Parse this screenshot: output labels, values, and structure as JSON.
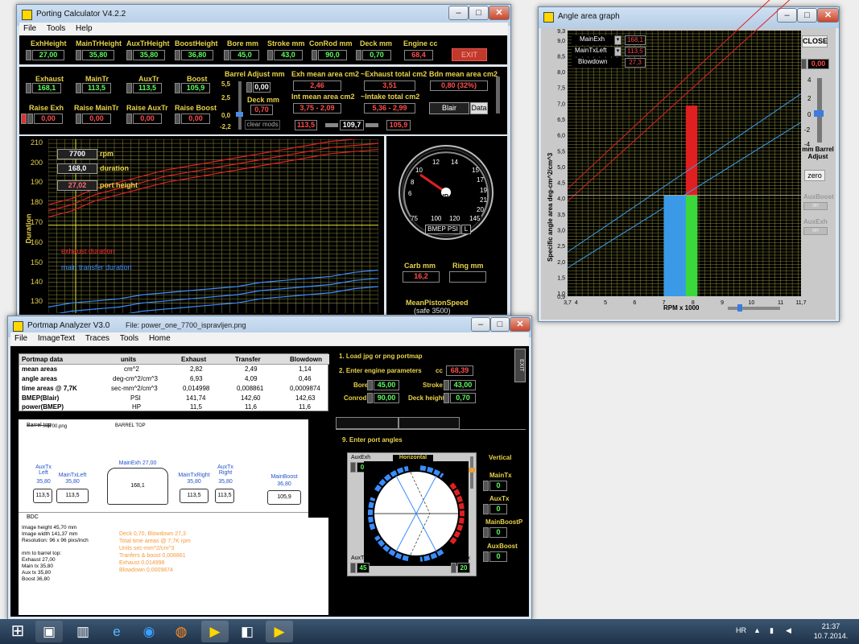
{
  "porting": {
    "title": "Porting Calculator V4.2.2",
    "menu": [
      "File",
      "Tools",
      "Help"
    ],
    "top_fields": [
      {
        "label": "ExhHeight",
        "value": "27,00"
      },
      {
        "label": "MainTrHeight",
        "value": "35,80"
      },
      {
        "label": "AuxTrHeight",
        "value": "35,80"
      },
      {
        "label": "BoostHeight",
        "value": "36,80"
      },
      {
        "label": "Bore mm",
        "value": "45,0"
      },
      {
        "label": "Stroke mm",
        "value": "43,0"
      },
      {
        "label": "ConRod mm",
        "value": "90,0"
      },
      {
        "label": "Deck mm",
        "value": "0,70"
      },
      {
        "label": "Engine cc",
        "value": "68,4"
      }
    ],
    "exit_label": "EXIT",
    "dur_fields": [
      {
        "label": "Exhaust",
        "value": "168,1"
      },
      {
        "label": "MainTr",
        "value": "113,5"
      },
      {
        "label": "AuxTr",
        "value": "113,5"
      },
      {
        "label": "Boost",
        "value": "105,9"
      }
    ],
    "raise_fields": [
      {
        "label": "Raise Exh",
        "value": "0,00"
      },
      {
        "label": "Raise MainTr",
        "value": "0,00"
      },
      {
        "label": "Raise AuxTr",
        "value": "0,00"
      },
      {
        "label": "Raise Boost",
        "value": "0,00"
      }
    ],
    "barrel_adjust_label": "Barrel Adjust mm",
    "barrel_adjust_value": "0,00",
    "barrel_scale": [
      "5,5",
      "2,5",
      "0,0",
      "-2,2"
    ],
    "deck_label": "Deck mm",
    "deck_value": "0,70",
    "clear_mods": "clear mods",
    "exh_mean_label": "Exh mean area cm2",
    "exh_mean_value": "2,46",
    "exh_total_label": "~Exhaust total cm2",
    "exh_total_value": "3,51",
    "bdn_label": "Bdn mean area cm2",
    "bdn_value": "0,80  (32%)",
    "int_mean_label": "Int mean area cm2",
    "int_mean_value": "3,75 - 2,09",
    "int_total_label": "~Intake total cm2",
    "int_total_value": "5,36 - 2,99",
    "blair_btn": "Blair",
    "data_btn": "Data",
    "val_a": "113,5",
    "val_b": "109,7",
    "val_c": "105,9",
    "rpm_value": "7700",
    "rpm_label": "rpm",
    "duration_value": "168,0",
    "duration_label": "duration",
    "port_height_value": "27,02",
    "port_height_label": "port height",
    "yaxis_label": "Duration",
    "y_ticks": [
      "210",
      "200",
      "190",
      "180",
      "170",
      "160",
      "150",
      "140",
      "130"
    ],
    "series_exhaust": "exhaust duration",
    "series_transfer": "main transfer duration",
    "gauge_ticks": [
      "10",
      "8",
      "6",
      "12",
      "14",
      "15",
      "17",
      "19",
      "21",
      "20",
      "75",
      "100",
      "120",
      "145"
    ],
    "gauge_unit": "HP",
    "gauge_mode": "BMEP PSI",
    "gauge_mode_sel": "L",
    "carb_label": "Carb mm",
    "carb_value": "16,2",
    "ring_label": "Ring mm",
    "piston_speed_label": "MeanPistonSpeed",
    "piston_speed_sub": "(safe 3500)"
  },
  "angle": {
    "title": "Angle area graph",
    "legend": [
      {
        "name": "MainExh",
        "value": "168,1"
      },
      {
        "name": "MainTxLeft",
        "value": "113,5"
      },
      {
        "name": "Blowdown",
        "value": "27,3"
      }
    ],
    "close_btn": "CLOSE",
    "adjust_value": "0,00",
    "adjust_ticks": [
      "4",
      "2",
      "0",
      "-2",
      "-4"
    ],
    "adjust_label": "mm Barrel Adjust",
    "zero_btn": "zero",
    "auxboost_label": "AuxBoost",
    "auxexh_label": "AuxExh",
    "on_label": "on",
    "ylabel": "Specific angle area  deg-cm^2/cm^3",
    "xlabel": "RPM x 1000",
    "y_ticks": [
      "9,3",
      "9,0",
      "8,5",
      "8,0",
      "7,5",
      "7,0",
      "6,5",
      "6,0",
      "5,5",
      "5,0",
      "4,5",
      "4,0",
      "3,5",
      "3,0",
      "2,5",
      "2,0",
      "1,5",
      "1,0",
      "0,9"
    ],
    "x_ticks": [
      "3,7",
      "4",
      "5",
      "6",
      "7",
      "8",
      "9",
      "10",
      "11",
      "11,7"
    ]
  },
  "portmap": {
    "title": "Portmap Analyzer V3.0",
    "file": "File: power_one_7700_ispravljen.png",
    "menu": [
      "File",
      "ImageText",
      "Traces",
      "Tools",
      "Home"
    ],
    "table_headers": [
      "Portmap data",
      "units",
      "Exhaust",
      "Transfer",
      "Blowdown"
    ],
    "table_rows": [
      [
        "mean areas",
        "cm^2",
        "2,82",
        "2,49",
        "1,14"
      ],
      [
        "angle areas",
        "deg-cm^2/cm^3",
        "6,93",
        "4,09",
        "0,46"
      ],
      [
        "time areas @ 7,7K",
        "sec-mm^2/cm^3",
        "0,014998",
        "0,008861",
        "0,0009874"
      ],
      [
        "BMEP(Blair)",
        "PSI",
        "141,74",
        "142,60",
        "142,63"
      ],
      [
        "power(BMEP)",
        "HP",
        "11,5",
        "11,6",
        "11,6"
      ]
    ],
    "step1": "1. Load jpg or png portmap",
    "step2": "2. Enter engine parameters",
    "cc_label": "cc",
    "cc_value": "68,39",
    "bore_label": "Bore",
    "bore_value": "45,00",
    "stroke_label": "Stroke",
    "stroke_value": "43,00",
    "conrod_label": "Conrod",
    "conrod_value": "90,00",
    "deck_label": "Deck height",
    "deck_value": "0,70",
    "exit_label": "EXIT",
    "step9": "9. Enter port angles",
    "auxexh_label": "AuxExh",
    "auxexh_value": "0",
    "horizontal_label": "Horizontal",
    "vertical_label": "Vertical",
    "v_fields": [
      {
        "label": "MainTx",
        "value": "0"
      },
      {
        "label": "AuxTx",
        "value": "0"
      },
      {
        "label": "MainBoostP",
        "value": "0"
      },
      {
        "label": "AuxBoost",
        "value": "0"
      }
    ],
    "auxtx_label": "AuxTx",
    "auxtx_value": "45",
    "maintx_label": "MainTx",
    "maintx_value": "20",
    "map_title1": "Barrel top",
    "map_file": "...7700.png",
    "map_title2": "BARREL TOP",
    "map_bdc": "BDC",
    "ports": [
      {
        "name": "AuxTx Left",
        "h": "35,80",
        "v": "113,5"
      },
      {
        "name": "MainTxLeft",
        "h": "35,80",
        "v": "113,5"
      },
      {
        "name": "MainExh 27,00",
        "h": "",
        "v": "168,1"
      },
      {
        "name": "MainTxRight",
        "h": "35,80",
        "v": "113,5"
      },
      {
        "name": "AuxTx Right",
        "h": "35,80",
        "v": "113,5"
      },
      {
        "name": "MainBoost",
        "h": "36,80",
        "v": "105,9"
      }
    ],
    "info_left": [
      "Image height  45,70 mm",
      "Image width  141,37 mm",
      "Resolution: 96 x 96 pixs/inch",
      "",
      "mm to barrel top:",
      "Exhaust  27,00",
      "Main tx   35,80",
      "Aux tx    35,80",
      "Boost     36,80"
    ],
    "info_right": [
      "Deck 0,70,  Blowdown 27,3",
      "Total time areas @ 7,7K rpm",
      "Units  sec-mm^2/cm^3",
      "Tranfers & boost  0,008861",
      "Exhaust  0,014998",
      "Blowdown  0,0009874"
    ]
  },
  "taskbar": {
    "lang": "HR",
    "time": "21:37",
    "date": "10.7.2014."
  },
  "chart_data": [
    {
      "type": "line",
      "title": "",
      "xlabel": "",
      "ylabel": "Duration",
      "ylim": [
        125,
        210
      ],
      "series": [
        {
          "name": "exhaust duration",
          "values": [
            175,
            178,
            183,
            186,
            189,
            192,
            194,
            196,
            198,
            200,
            202,
            204,
            206,
            207,
            208
          ]
        },
        {
          "name": "main transfer duration",
          "values": [
            124,
            126,
            127,
            128,
            130,
            131,
            132,
            133,
            134,
            136,
            137,
            138,
            139,
            141,
            142
          ]
        }
      ]
    },
    {
      "type": "bar",
      "title": "",
      "xlabel": "RPM x 1000",
      "ylabel": "Specific angle area  deg-cm^2/cm^3",
      "xlim": [
        3.7,
        11.7
      ],
      "ylim": [
        0.9,
        9.3
      ],
      "series": [
        {
          "name": "MainExh",
          "values": [
            6.93
          ]
        },
        {
          "name": "MainTxLeft",
          "values": [
            4.09
          ]
        },
        {
          "name": "Blowdown",
          "values": [
            0.46
          ]
        }
      ]
    }
  ]
}
